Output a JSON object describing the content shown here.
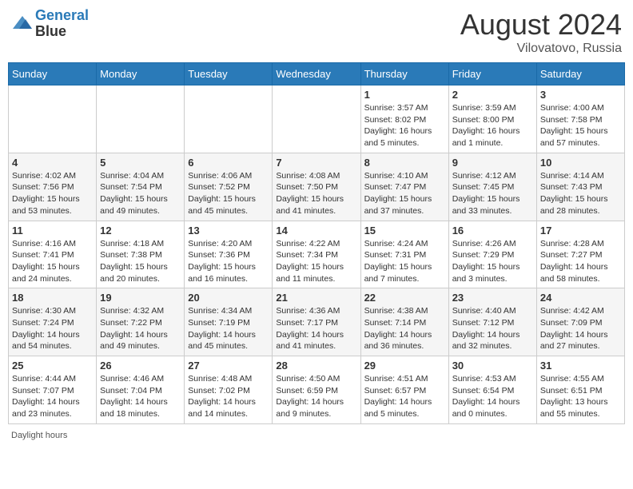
{
  "header": {
    "logo_line1": "General",
    "logo_line2": "Blue",
    "month_title": "August 2024",
    "subtitle": "Vilovatovo, Russia"
  },
  "footer": {
    "daylight_label": "Daylight hours"
  },
  "days_of_week": [
    "Sunday",
    "Monday",
    "Tuesday",
    "Wednesday",
    "Thursday",
    "Friday",
    "Saturday"
  ],
  "weeks": [
    [
      {
        "day": "",
        "info": ""
      },
      {
        "day": "",
        "info": ""
      },
      {
        "day": "",
        "info": ""
      },
      {
        "day": "",
        "info": ""
      },
      {
        "day": "1",
        "info": "Sunrise: 3:57 AM\nSunset: 8:02 PM\nDaylight: 16 hours and 5 minutes."
      },
      {
        "day": "2",
        "info": "Sunrise: 3:59 AM\nSunset: 8:00 PM\nDaylight: 16 hours and 1 minute."
      },
      {
        "day": "3",
        "info": "Sunrise: 4:00 AM\nSunset: 7:58 PM\nDaylight: 15 hours and 57 minutes."
      }
    ],
    [
      {
        "day": "4",
        "info": "Sunrise: 4:02 AM\nSunset: 7:56 PM\nDaylight: 15 hours and 53 minutes."
      },
      {
        "day": "5",
        "info": "Sunrise: 4:04 AM\nSunset: 7:54 PM\nDaylight: 15 hours and 49 minutes."
      },
      {
        "day": "6",
        "info": "Sunrise: 4:06 AM\nSunset: 7:52 PM\nDaylight: 15 hours and 45 minutes."
      },
      {
        "day": "7",
        "info": "Sunrise: 4:08 AM\nSunset: 7:50 PM\nDaylight: 15 hours and 41 minutes."
      },
      {
        "day": "8",
        "info": "Sunrise: 4:10 AM\nSunset: 7:47 PM\nDaylight: 15 hours and 37 minutes."
      },
      {
        "day": "9",
        "info": "Sunrise: 4:12 AM\nSunset: 7:45 PM\nDaylight: 15 hours and 33 minutes."
      },
      {
        "day": "10",
        "info": "Sunrise: 4:14 AM\nSunset: 7:43 PM\nDaylight: 15 hours and 28 minutes."
      }
    ],
    [
      {
        "day": "11",
        "info": "Sunrise: 4:16 AM\nSunset: 7:41 PM\nDaylight: 15 hours and 24 minutes."
      },
      {
        "day": "12",
        "info": "Sunrise: 4:18 AM\nSunset: 7:38 PM\nDaylight: 15 hours and 20 minutes."
      },
      {
        "day": "13",
        "info": "Sunrise: 4:20 AM\nSunset: 7:36 PM\nDaylight: 15 hours and 16 minutes."
      },
      {
        "day": "14",
        "info": "Sunrise: 4:22 AM\nSunset: 7:34 PM\nDaylight: 15 hours and 11 minutes."
      },
      {
        "day": "15",
        "info": "Sunrise: 4:24 AM\nSunset: 7:31 PM\nDaylight: 15 hours and 7 minutes."
      },
      {
        "day": "16",
        "info": "Sunrise: 4:26 AM\nSunset: 7:29 PM\nDaylight: 15 hours and 3 minutes."
      },
      {
        "day": "17",
        "info": "Sunrise: 4:28 AM\nSunset: 7:27 PM\nDaylight: 14 hours and 58 minutes."
      }
    ],
    [
      {
        "day": "18",
        "info": "Sunrise: 4:30 AM\nSunset: 7:24 PM\nDaylight: 14 hours and 54 minutes."
      },
      {
        "day": "19",
        "info": "Sunrise: 4:32 AM\nSunset: 7:22 PM\nDaylight: 14 hours and 49 minutes."
      },
      {
        "day": "20",
        "info": "Sunrise: 4:34 AM\nSunset: 7:19 PM\nDaylight: 14 hours and 45 minutes."
      },
      {
        "day": "21",
        "info": "Sunrise: 4:36 AM\nSunset: 7:17 PM\nDaylight: 14 hours and 41 minutes."
      },
      {
        "day": "22",
        "info": "Sunrise: 4:38 AM\nSunset: 7:14 PM\nDaylight: 14 hours and 36 minutes."
      },
      {
        "day": "23",
        "info": "Sunrise: 4:40 AM\nSunset: 7:12 PM\nDaylight: 14 hours and 32 minutes."
      },
      {
        "day": "24",
        "info": "Sunrise: 4:42 AM\nSunset: 7:09 PM\nDaylight: 14 hours and 27 minutes."
      }
    ],
    [
      {
        "day": "25",
        "info": "Sunrise: 4:44 AM\nSunset: 7:07 PM\nDaylight: 14 hours and 23 minutes."
      },
      {
        "day": "26",
        "info": "Sunrise: 4:46 AM\nSunset: 7:04 PM\nDaylight: 14 hours and 18 minutes."
      },
      {
        "day": "27",
        "info": "Sunrise: 4:48 AM\nSunset: 7:02 PM\nDaylight: 14 hours and 14 minutes."
      },
      {
        "day": "28",
        "info": "Sunrise: 4:50 AM\nSunset: 6:59 PM\nDaylight: 14 hours and 9 minutes."
      },
      {
        "day": "29",
        "info": "Sunrise: 4:51 AM\nSunset: 6:57 PM\nDaylight: 14 hours and 5 minutes."
      },
      {
        "day": "30",
        "info": "Sunrise: 4:53 AM\nSunset: 6:54 PM\nDaylight: 14 hours and 0 minutes."
      },
      {
        "day": "31",
        "info": "Sunrise: 4:55 AM\nSunset: 6:51 PM\nDaylight: 13 hours and 55 minutes."
      }
    ]
  ]
}
